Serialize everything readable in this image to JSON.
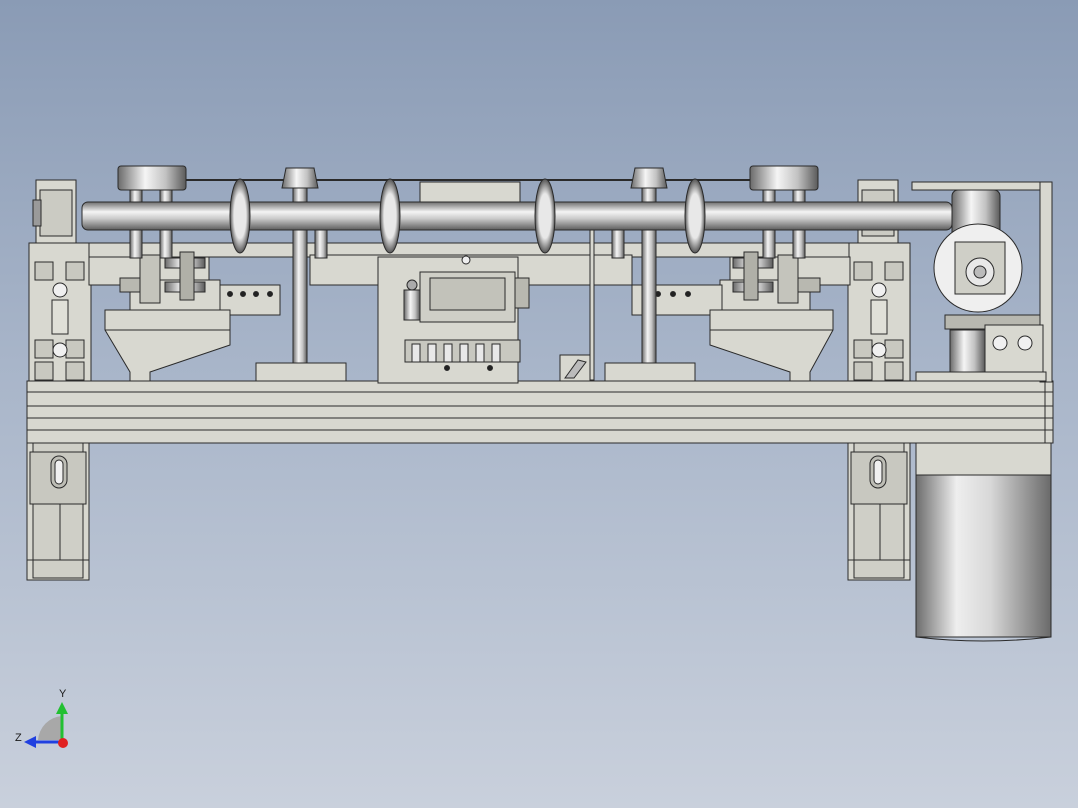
{
  "view": {
    "background_top": "#8a9bb5",
    "background_bottom": "#c9d0dc",
    "model_fill": "#d8d8d0",
    "model_stroke": "#2a2a2a",
    "metal_light": "#f2f2f2",
    "metal_dark": "#7a7a7a"
  },
  "triad": {
    "y_label": "Y",
    "z_label": "Z",
    "y_color": "#22c032",
    "z_color": "#2040e0",
    "x_color": "#e02020"
  }
}
